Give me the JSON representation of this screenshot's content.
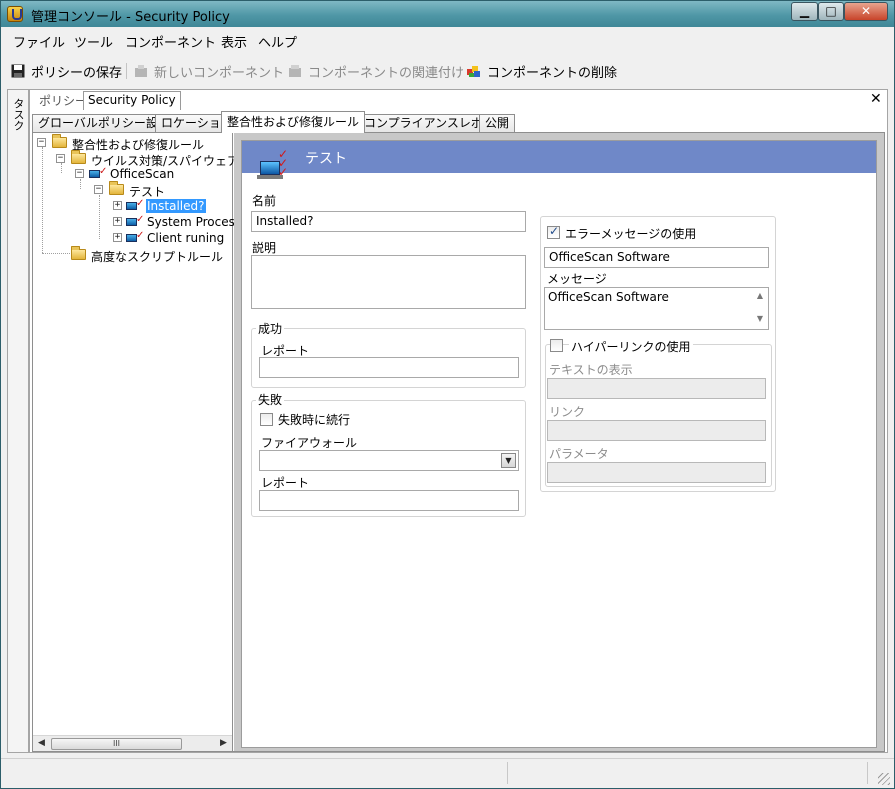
{
  "window": {
    "title": "管理コンソール - Security Policy"
  },
  "menu": [
    "ファイル",
    "ツール",
    "コンポーネント",
    "表示",
    "ヘルプ"
  ],
  "toolbar": {
    "save": "ポリシーの保存",
    "new_component": "新しいコンポーネント",
    "associate_component": "コンポーネントの関連付け",
    "delete_component": "コンポーネントの削除"
  },
  "side_panel": {
    "label": "タスク"
  },
  "doc_tabs": {
    "policy_label": "ポリシー",
    "policy_name": "Security Policy"
  },
  "tabs": [
    "グローバルポリシー設定",
    "ロケーション",
    "整合性および修復ルール",
    "コンプライアンスレポート",
    "公開"
  ],
  "tree": {
    "root": "整合性および修復ルール",
    "antivirus": "ウイルス対策/スパイウェアル",
    "officescan": "OfficeScan",
    "test": "テスト",
    "installed": "Installed?",
    "system_process": "System Proces",
    "client_running": "Client runing",
    "advanced_script": "高度なスクリプトルール",
    "scroll_thumb": "III"
  },
  "form": {
    "header_title": "テスト",
    "name_label": "名前",
    "name_value": "Installed?",
    "description_label": "説明",
    "description_value": "",
    "success_group": "成功",
    "success_report_label": "レポート",
    "success_report_value": "",
    "failure_group": "失敗",
    "continue_on_failure_label": "失敗時に続行",
    "continue_on_failure_checked": false,
    "firewall_label": "ファイアウォール",
    "firewall_value": "",
    "failure_report_label": "レポート",
    "failure_report_value": "",
    "use_error_message_label": "エラーメッセージの使用",
    "use_error_message_checked": true,
    "error_title_value": "OfficeScan Software",
    "message_label": "メッセージ",
    "message_value": "OfficeScan Software",
    "use_hyperlink_label": "ハイパーリンクの使用",
    "use_hyperlink_checked": false,
    "display_text_label": "テキストの表示",
    "link_label": "リンク",
    "parameter_label": "パラメータ"
  },
  "colors": {
    "header_strip": "#6f88c8",
    "selection": "#3399ff",
    "title_bar": "#4f97a6"
  }
}
